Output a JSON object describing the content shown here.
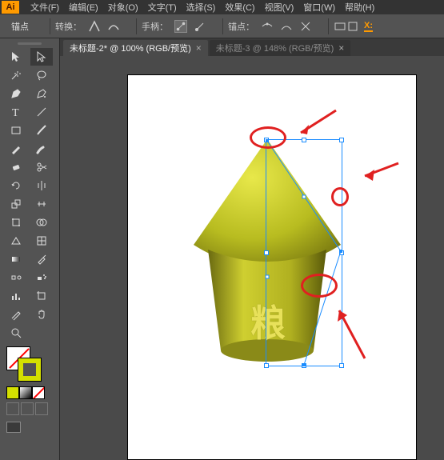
{
  "app": {
    "logo": "Ai"
  },
  "menu": {
    "file": "文件(F)",
    "edit": "编辑(E)",
    "object": "对象(O)",
    "type": "文字(T)",
    "select": "选择(S)",
    "effect": "效果(C)",
    "view": "视图(V)",
    "window": "窗口(W)",
    "help": "帮助(H)"
  },
  "controlbar": {
    "anchor": "锚点",
    "convert": "转换：",
    "handle": "手柄：",
    "anchors": "锚点："
  },
  "tabs": [
    {
      "label": "未标题-2* @ 100% (RGB/预览)",
      "active": true
    },
    {
      "label": "未标题-3 @ 148% (RGB/预览)",
      "active": false
    }
  ],
  "colors": {
    "stroke": "#d4e000",
    "accent": "#ff9a00",
    "annotation": "#e02020",
    "selection": "#1a8cff"
  },
  "artwork": {
    "character": "粮"
  }
}
